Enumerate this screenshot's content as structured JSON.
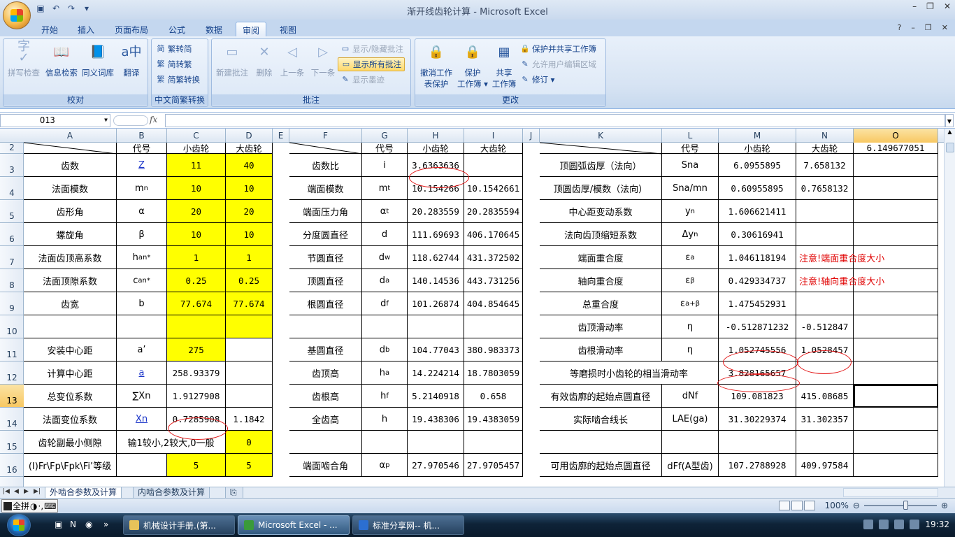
{
  "window": {
    "title": "渐开线齿轮计算 - Microsoft Excel"
  },
  "qat": {
    "save_icon": "save-icon",
    "undo_icon": "undo-icon",
    "redo_icon": "redo-icon"
  },
  "menu_tabs": [
    "开始",
    "插入",
    "页面布局",
    "公式",
    "数据",
    "审阅",
    "视图"
  ],
  "active_tab": "审阅",
  "ribbon": {
    "proof": {
      "label": "校对",
      "buttons": [
        "拼写检查",
        "信息检索",
        "同义词库",
        "翻译"
      ]
    },
    "chinese": {
      "label": "中文简繁转换",
      "buttons": [
        "繁转简",
        "简转繁",
        "简繁转换"
      ]
    },
    "comments": {
      "label": "批注",
      "buttons": [
        "新建批注",
        "删除",
        "上一条",
        "下一条"
      ],
      "small": [
        "显示/隐藏批注",
        "显示所有批注",
        "显示墨迹"
      ]
    },
    "changes": {
      "label": "更改",
      "big1": [
        "撤消工作",
        "表保护"
      ],
      "big2": [
        "保护",
        "工作簿 ▾"
      ],
      "big3": [
        "共享",
        "工作簿"
      ],
      "small": [
        "保护并共享工作簿",
        "允许用户编辑区域",
        "修订 ▾"
      ]
    }
  },
  "formula_bar": {
    "name_box": "O13",
    "fx": "fx",
    "formula": ""
  },
  "columns": [
    "A",
    "B",
    "C",
    "D",
    "E",
    "F",
    "G",
    "H",
    "I",
    "J",
    "K",
    "L",
    "M",
    "N",
    "O"
  ],
  "selected_column": "O",
  "rows": [
    "2",
    "3",
    "4",
    "5",
    "6",
    "7",
    "8",
    "9",
    "10",
    "11",
    "12",
    "13",
    "14",
    "15",
    "16"
  ],
  "selected_row": "13",
  "sheet": {
    "r2": {
      "B": "代号",
      "C": "小齿轮",
      "D": "大齿轮",
      "G": "代号",
      "H": "小齿轮",
      "I": "大齿轮",
      "L": "代号",
      "M": "小齿轮",
      "N": "大齿轮",
      "O": "6.149677051"
    },
    "r3": {
      "A": "齿数",
      "B": "Z",
      "C": "11",
      "D": "40",
      "F": "齿数比",
      "G": "i",
      "H": "3.6363636",
      "K": "顶圆弧齿厚（法向）",
      "L": "Sna",
      "M": "6.0955895",
      "N": "7.658132"
    },
    "r4": {
      "A": "法面模数",
      "B": "m",
      "B_sub": "n",
      "C": "10",
      "D": "10",
      "F": "端面模数",
      "G": "m",
      "G_sub": "t",
      "H": "10.154266",
      "I": "10.1542661",
      "K": "顶圆齿厚/模数（法向）",
      "L": "Sna/mn",
      "M": "0.60955895",
      "N": "0.7658132"
    },
    "r5": {
      "A": "齿形角",
      "B": "α",
      "C": "20",
      "D": "20",
      "F": "端面压力角",
      "G": "α ",
      "G_sub": "t",
      "H": "20.283559",
      "I": "20.2835594",
      "K": "中心距变动系数",
      "L": "y",
      "L_sub": "n",
      "M": "1.606621411"
    },
    "r6": {
      "A": "螺旋角",
      "B": "β",
      "C": "10",
      "D": "10",
      "F": "分度圆直径",
      "G": "d",
      "H": "111.69693",
      "I": "406.170645",
      "K": "法向齿顶缩短系数",
      "L": "Δy",
      "L_sub": "n",
      "M": "0.30616941"
    },
    "r7": {
      "A": "法面齿顶高系数",
      "B": "h",
      "B_sub": "an",
      "B_sup": "*",
      "C": "1",
      "D": "1",
      "F": "节圆直径",
      "G": "d",
      "G_sub": "w",
      "H": "118.62744",
      "I": "431.372502",
      "K": "端面重合度",
      "L": "ε ",
      "L_sub": "a",
      "M": "1.046118194",
      "N": "注意!端面重合度大小"
    },
    "r8": {
      "A": "法面顶隙系数",
      "B": "c",
      "B_sub": "an",
      "B_sup": "*",
      "C": "0.25",
      "D": "0.25",
      "F": "顶圆直径",
      "G": "d",
      "G_sub": "a",
      "H": "140.14536",
      "I": "443.731256",
      "K": "轴向重合度",
      "L": "ε ",
      "L_sub": "β",
      "M": "0.429334737",
      "N": "注意!轴向重合度大小"
    },
    "r9": {
      "A": "齿宽",
      "B": "b",
      "C": "77.674",
      "D": "77.674",
      "F": "根圆直径",
      "G": "d",
      "G_sub": "f",
      "H": "101.26874",
      "I": "404.854645",
      "K": "总重合度",
      "L": "ε ",
      "L_sub": "a+β",
      "M": "1.475452931"
    },
    "r10": {
      "K": "齿顶滑动率",
      "L": "η",
      "M": "-0.512871232",
      "N": "-0.512847"
    },
    "r11": {
      "A": "安装中心距",
      "B": "a’",
      "C": "275",
      "F": "基圆直径",
      "G": "d",
      "G_sub": "b",
      "H": "104.77043",
      "I": "380.983373",
      "K": "齿根滑动率",
      "L": "η",
      "M": "1.052745556",
      "N": "1.0528457"
    },
    "r12": {
      "A": "计算中心距",
      "B": "a",
      "C": "258.93379",
      "F": "齿顶高",
      "G": "h",
      "G_sub": "a",
      "H": "14.224214",
      "I": "18.7803059",
      "K": "等磨损时小齿轮的相当滑动率",
      "M": "3.828165657"
    },
    "r13": {
      "A": "总变位系数",
      "B": "∑Xn",
      "C": "1.9127908",
      "F": "齿根高",
      "G": "h",
      "G_sub": "f",
      "H": "5.2140918",
      "I": "0.658",
      "K": "有效齿廓的起始点圆直径",
      "L": "dNf",
      "M": "109.081823",
      "N": "415.08685"
    },
    "r14": {
      "A": "法面变位系数",
      "B": "Xn",
      "C": "0.7285908",
      "D": "1.1842",
      "F": "全齿高",
      "G": "h",
      "H": "19.438306",
      "I": "19.4383059",
      "K": "实际啮合线长",
      "L": "LAE(ga)",
      "M": "31.30229374",
      "N": "31.302357"
    },
    "r15": {
      "A": "齿轮副最小侧隙",
      "B": "输1较小,2较大,0一般",
      "D": "0"
    },
    "r16": {
      "A": "(Ⅰ)Fr\\Fp\\Fpk\\Fi’等级",
      "C": "5",
      "D": "5",
      "F": "端面啮合角",
      "G": "α ",
      "G_sub": "p",
      "H": "27.970546",
      "I": "27.9705457",
      "K": "可用齿廓的起始点圆直径",
      "L": "dFf(A型齿)",
      "M": "107.2788928",
      "N": "409.97584"
    }
  },
  "sheet_tabs": [
    "外啮合参数及计算",
    "内啮合参数及计算"
  ],
  "active_sheet": "外啮合参数及计算",
  "status": {
    "ime": "全拼",
    "zoom": "100%"
  },
  "taskbar": {
    "tasks": [
      "机械设计手册.(第...",
      "Microsoft Excel - ...",
      "标准分享网-- 机..."
    ],
    "clock": "19:32"
  }
}
